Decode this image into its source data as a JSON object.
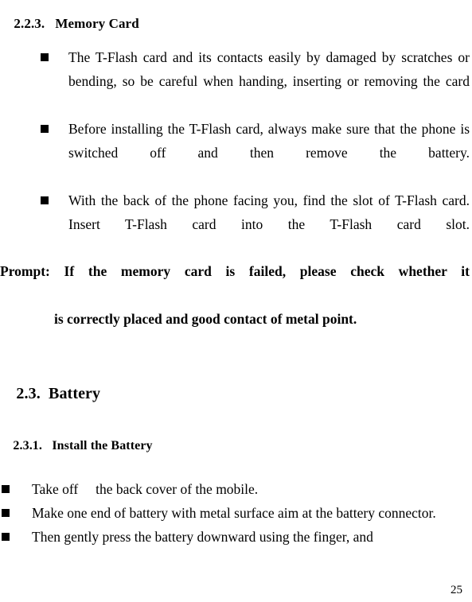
{
  "document": {
    "page_number": "25"
  },
  "sections": {
    "memory_card": {
      "number": "2.2.3.",
      "title": "Memory Card",
      "bullets": [
        "The T-Flash card and its contacts easily by damaged by scratches or bending, so be careful when handing, inserting or removing the card",
        "Before installing the T-Flash card, always make sure that the phone is switched off and then remove the battery.",
        "With the back of the phone facing you, find the slot of T-Flash card. Insert T-Flash card into the T-Flash card slot."
      ],
      "prompt": {
        "line1": "Prompt: If the memory card is failed, please check whether it",
        "line2": "is correctly placed and good contact of metal point."
      }
    },
    "battery": {
      "number": "2.3.",
      "title": "Battery"
    },
    "install_battery": {
      "number": "2.3.1.",
      "title": "Install the Battery",
      "bullets": [
        "Take off　 the back cover of the mobile.",
        "Make one end of battery with metal surface aim at the battery connector.",
        "Then gently press the battery downward using the finger, and"
      ]
    }
  }
}
